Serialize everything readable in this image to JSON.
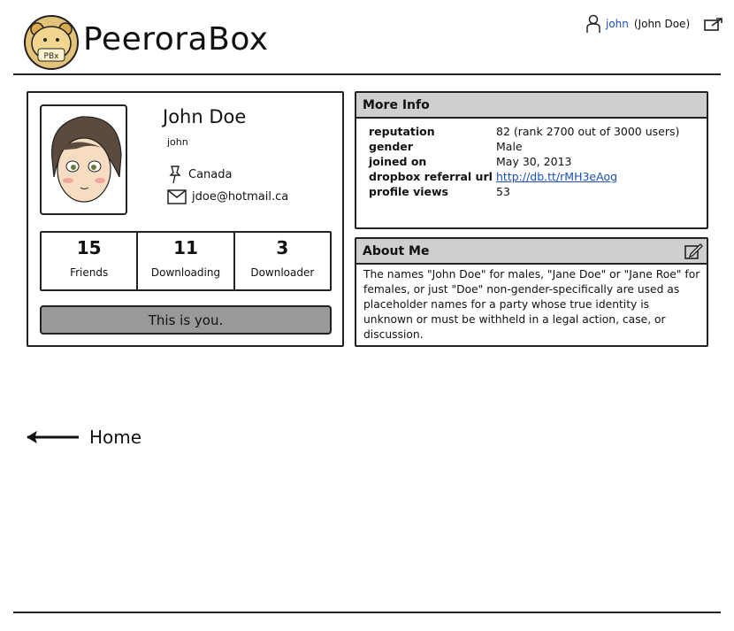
{
  "brand": {
    "logo_text": "PeeroraBox",
    "badge_text": "PBx"
  },
  "user_menu": {
    "username": "john",
    "full_name_suffix": "(John Doe)"
  },
  "profile": {
    "name": "John Doe",
    "username": "john",
    "location": "Canada",
    "email": "jdoe@hotmail.ca",
    "stats": [
      {
        "value": "15",
        "label": "Friends"
      },
      {
        "value": "11",
        "label": "Downloading"
      },
      {
        "value": "3",
        "label": "Downloader"
      }
    ],
    "self_notice": "This is you."
  },
  "more_info": {
    "title": "More Info",
    "rows": [
      {
        "key": "reputation",
        "value": "82 (rank 2700 out of 3000 users)"
      },
      {
        "key": "gender",
        "value": "Male"
      },
      {
        "key": "joined on",
        "value": "May 30, 2013"
      },
      {
        "key": "dropbox referral url",
        "value": "http://db.tt/rMH3eAog"
      },
      {
        "key": "profile views",
        "value": "53"
      }
    ]
  },
  "about_me": {
    "title": "About Me",
    "text": "The names \"John Doe\" for males, \"Jane Doe\" or \"Jane Roe\" for females, or just \"Doe\" non-gender-specifically are used as placeholder names for a party whose true identity is unknown or must be withheld in a legal action, case, or discussion."
  },
  "nav": {
    "home_label": "Home"
  },
  "colors": {
    "link": "#1a4fb3",
    "panel_header": "#cfcfcf",
    "notice_bar": "#999999"
  },
  "icons": [
    "logo-badge",
    "user-icon",
    "logout-icon",
    "pin-icon",
    "envelope-icon",
    "edit-icon",
    "arrow-left-icon"
  ]
}
